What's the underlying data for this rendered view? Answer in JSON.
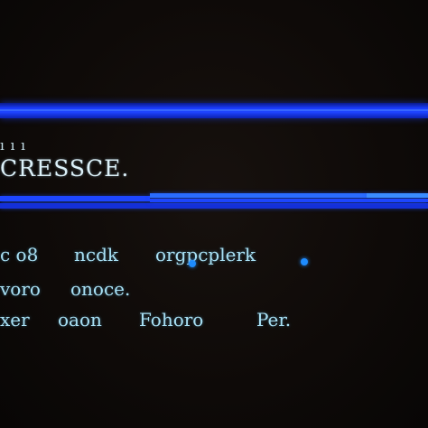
{
  "screen": {
    "accent_color": "#1d46ff",
    "text_color": "#a8e0f4",
    "background_color": "#0e0a08"
  },
  "header": {
    "small_label": "ı ı ı",
    "title": "CRESSCE."
  },
  "rows": [
    {
      "cells": [
        "c o8",
        "ncdk",
        "orgpcplerk"
      ]
    },
    {
      "cells": [
        "voro",
        "onoce."
      ]
    },
    {
      "cells": [
        "xer",
        "oaon",
        "Fohoro",
        "Per."
      ]
    }
  ]
}
